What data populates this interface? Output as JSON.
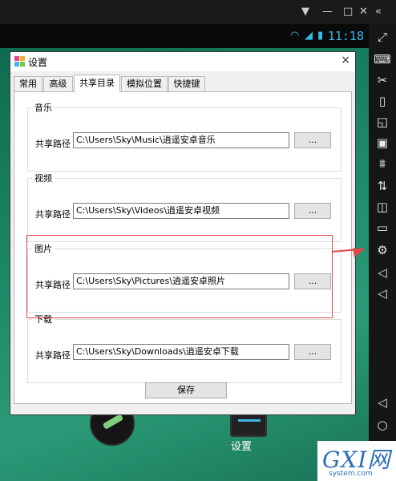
{
  "emulator": {
    "top_icons": [
      "download-icon",
      "minimize-icon",
      "maximize-icon",
      "close-icon",
      "collapse-icon"
    ],
    "status_time": "11:18",
    "sidebar_icons": [
      "fullscreen-icon",
      "keyboard-icon",
      "scissors-icon",
      "vibrate-icon",
      "rotate-icon",
      "apk-icon",
      "broom-icon",
      "transfer-icon",
      "shake-icon",
      "record-icon",
      "settings-icon",
      "volume-up-icon",
      "volume-down-icon",
      "back-icon",
      "home-icon"
    ]
  },
  "window": {
    "title": "设置",
    "close_glyph": "×",
    "tabs": [
      "常用",
      "高级",
      "共享目录",
      "模拟位置",
      "快捷键"
    ],
    "active_tab": "共享目录",
    "groups": [
      {
        "title": "音乐",
        "label": "共享路径",
        "path": "C:\\Users\\Sky\\Music\\逍遥安卓音乐",
        "button": "..."
      },
      {
        "title": "视频",
        "label": "共享路径",
        "path": "C:\\Users\\Sky\\Videos\\逍遥安卓视频",
        "button": "..."
      },
      {
        "title": "图片",
        "label": "共享路径",
        "path": "C:\\Users\\Sky\\Pictures\\逍遥安卓照片",
        "button": "..."
      },
      {
        "title": "下载",
        "label": "共享路径",
        "path": "C:\\Users\\Sky\\Downloads\\逍遥安卓下载",
        "button": "..."
      }
    ],
    "save_label": "保存"
  },
  "desktop": {
    "settings_app_label": "设置"
  },
  "watermark": {
    "main": "GXI网",
    "sub": "system.com"
  },
  "colors": {
    "desktop_green": "#1f8a6a",
    "highlight_red": "#e04848",
    "status_blue": "#3ab8e8"
  }
}
